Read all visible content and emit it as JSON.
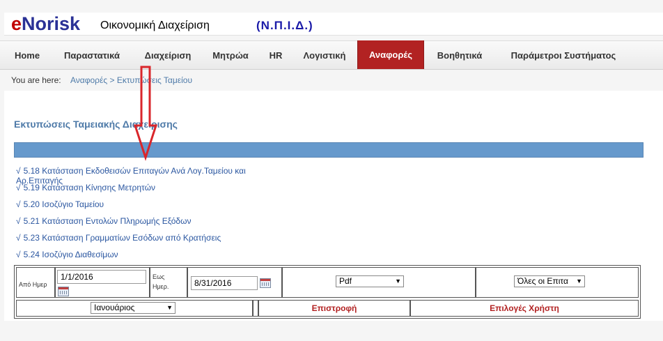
{
  "header": {
    "logo_e": "e",
    "logo_rest": "Norisk",
    "app_title": "Οικονομική Διαχείριση",
    "org": "(Ν.Π.Ι.Δ.)"
  },
  "nav": {
    "items": [
      {
        "label": "Home"
      },
      {
        "label": "Παραστατικά"
      },
      {
        "label": "Διαχείριση"
      },
      {
        "label": "Μητρώα"
      },
      {
        "label": "HR"
      },
      {
        "label": "Λογιστική"
      },
      {
        "label": "Αναφορές"
      },
      {
        "label": "Βοηθητικά"
      },
      {
        "label": "Παράμετροι Συστήματος"
      }
    ],
    "active_index": 6
  },
  "breadcrumb": {
    "prefix": "You are here:",
    "level1": "Αναφορές",
    "sep": ">",
    "level2": "Εκτυπώσεις Ταμείου"
  },
  "section": {
    "title": "Εκτυπώσεις Ταμειακής Διαχείρισης"
  },
  "reports": [
    {
      "check": "√",
      "label": "5.18 Κατάσταση Εκδοθεισών Επιταγών Ανά Λογ.Ταμείου και Αρ.Επιταγής"
    },
    {
      "check": "√",
      "label": "5.19 Κατάσταση Κίνησης Μετρητών"
    },
    {
      "check": "√",
      "label": "5.20 Ισοζύγιο Ταμείου"
    },
    {
      "check": "√",
      "label": "5.21 Κατάσταση Εντολών Πληρωμής Εξόδων"
    },
    {
      "check": "√",
      "label": "5.23 Κατάσταση Γραμματίων Εσόδων από Κρατήσεις"
    },
    {
      "check": "√",
      "label": "5.24 Ισοζύγιο Διαθεσίμων"
    }
  ],
  "form": {
    "from_label": "Από Ημερ",
    "from_value": "1/1/2016",
    "to_label_1": "Εως",
    "to_label_2": "Ημερ.",
    "to_value": "8/31/2016",
    "format_value": "Pdf",
    "checks_value": "Όλες οι Επιτα",
    "month_value": "Ιανουάριος",
    "back_label": "Επιστροφή",
    "user_options_label": "Επιλογές Χρήστη"
  },
  "colors": {
    "active_tab": "#b22222",
    "logo_e": "#c00000",
    "logo_rest": "#2a3196",
    "link": "#4e7aa8",
    "bar": "#6699cc",
    "annotation_arrow": "#d9262b"
  }
}
